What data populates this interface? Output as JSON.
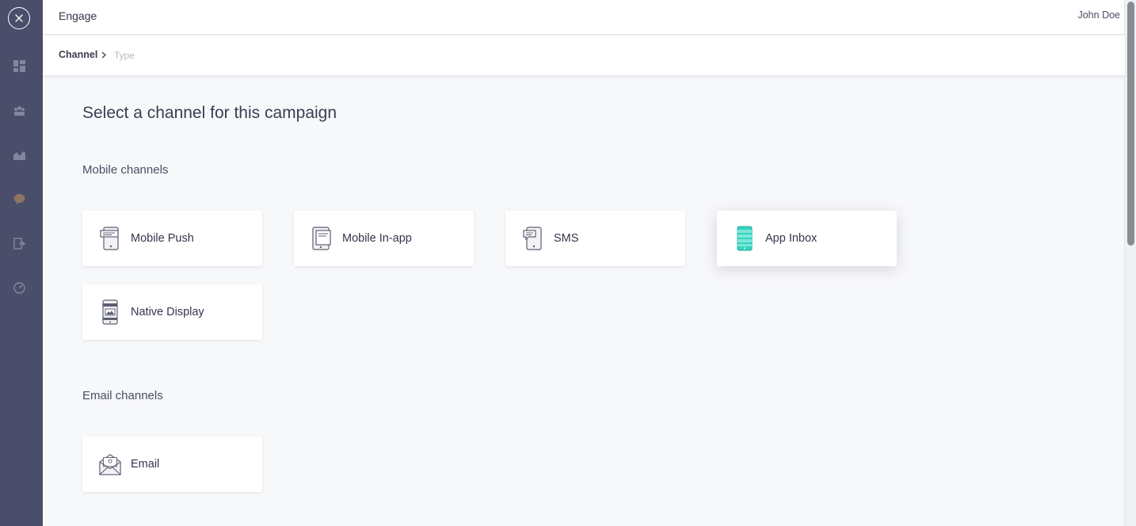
{
  "header": {
    "app_title": "Engage",
    "user_name": "John Doe"
  },
  "breadcrumb": {
    "active": "Channel",
    "inactive": "Type"
  },
  "rail": {
    "icons": [
      "dashboard-icon",
      "segments-icon",
      "analytics-icon",
      "chat-icon",
      "export-icon",
      "gauge-icon"
    ]
  },
  "main": {
    "title": "Select a channel for this campaign",
    "mobile_section": {
      "title": "Mobile channels",
      "cards": [
        {
          "label": "Mobile Push",
          "icon": "mobile-push-icon"
        },
        {
          "label": "Mobile In-app",
          "icon": "mobile-in-app-icon"
        },
        {
          "label": "SMS",
          "icon": "sms-icon"
        },
        {
          "label": "App Inbox",
          "icon": "app-inbox-icon",
          "accent": "#35d3c1"
        },
        {
          "label": "Native Display",
          "icon": "native-display-icon"
        }
      ]
    },
    "email_section": {
      "title": "Email channels",
      "cards": [
        {
          "label": "Email",
          "icon": "email-icon"
        }
      ]
    }
  },
  "colors": {
    "rail": "#4a4e6b",
    "background": "#f7f8fa",
    "accent": "#35d3c1",
    "text": "#33364a"
  }
}
